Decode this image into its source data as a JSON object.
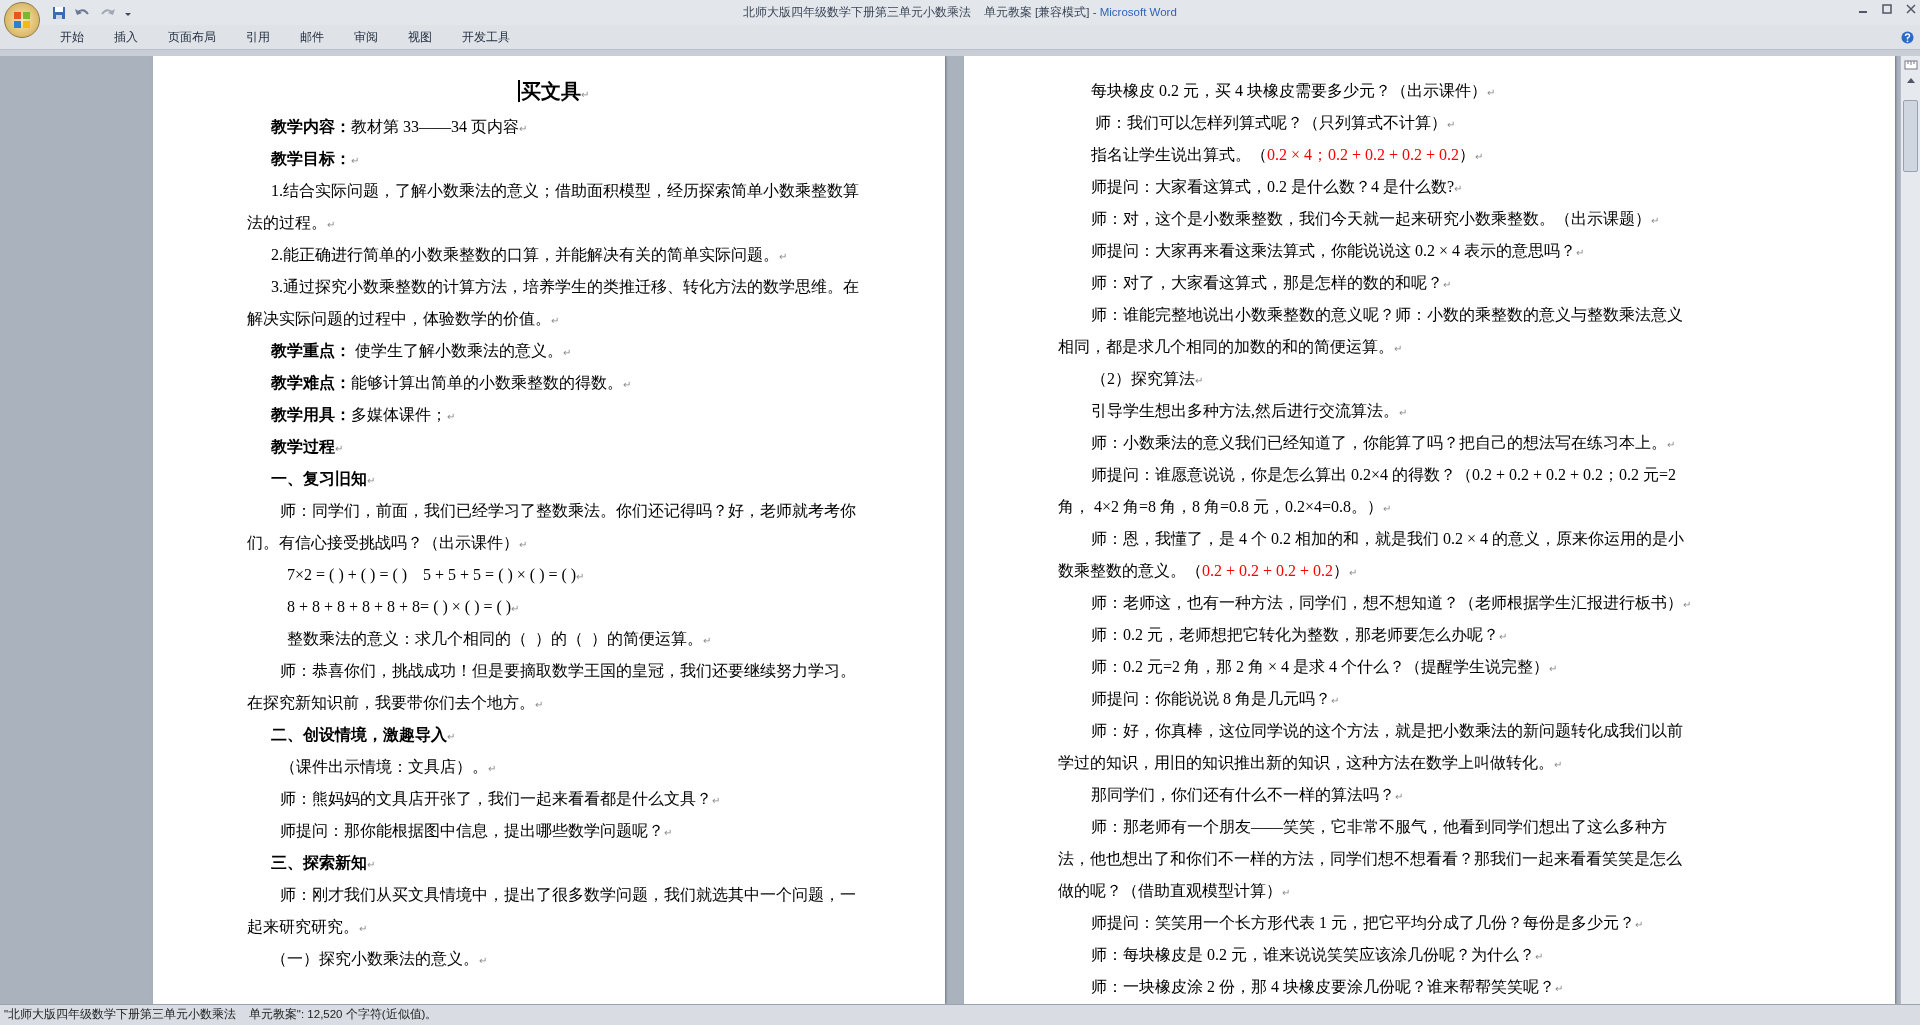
{
  "window": {
    "title": "北师大版四年级数学下册第三单元小数乘法    单元教案 [兼容模式] - ",
    "app_name": "Microsoft Word"
  },
  "ribbon_tabs": [
    {
      "label": "开始"
    },
    {
      "label": "插入"
    },
    {
      "label": "页面布局"
    },
    {
      "label": "引用"
    },
    {
      "label": "邮件"
    },
    {
      "label": "审阅"
    },
    {
      "label": "视图"
    },
    {
      "label": "开发工具"
    }
  ],
  "pages": [
    {
      "paragraphs": [
        {
          "kind": "title",
          "text": "买文具",
          "end": "↵"
        },
        {
          "kind": "item",
          "text": "**教学内容：**教材第 33——34 页内容",
          "end": "↵"
        },
        {
          "kind": "heading",
          "text": "教学目标：",
          "end": "↵"
        },
        {
          "kind": "item",
          "text": "1.结合实际问题，了解小数乘法的意义；借助面积模型，经历探索简单小数乘整数算法的过程。",
          "end": "↵"
        },
        {
          "kind": "item",
          "text": "2.能正确进行简单的小数乘整数的口算，并能解决有关的简单实际问题。",
          "end": "↵"
        },
        {
          "kind": "item",
          "text": "3.通过探究小数乘整数的计算方法，培养学生的类推迁移、转化方法的数学思维。在解决实际问题的过程中，体验数学的价值。",
          "end": "↵"
        },
        {
          "kind": "item",
          "text": "**教学重点：** 使学生了解小数乘法的意义。",
          "end": "↵"
        },
        {
          "kind": "item",
          "text": "**教学难点：**能够计算出简单的小数乘整数的得数。",
          "end": "↵"
        },
        {
          "kind": "item",
          "text": "**教学用具：**多媒体课件；",
          "end": "↵"
        },
        {
          "kind": "heading",
          "text": "教学过程",
          "end": "↵"
        },
        {
          "kind": "heading",
          "text": "一、复习旧知",
          "end": "↵"
        },
        {
          "kind": "dialogue",
          "text": "师：同学们，前面，我们已经学习了整数乘法。你们还记得吗？好，老师就考考你们。有信心接受挑战吗？（出示课件）",
          "end": "↵"
        },
        {
          "kind": "formula",
          "text": "7×2 = ( ) + ( ) = ( )    5 + 5 + 5 = ( ) × ( ) = ( )",
          "end": "↵"
        },
        {
          "kind": "formula",
          "text": "8 + 8 + 8 + 8 + 8 + 8= ( ) × ( ) = ( )",
          "end": "↵"
        },
        {
          "kind": "formula",
          "text": "整数乘法的意义：求几个相同的（  ）的（  ）的简便运算。",
          "end": "↵"
        },
        {
          "kind": "dialogue",
          "text": "师：恭喜你们，挑战成功！但是要摘取数学王国的皇冠，我们还要继续努力学习。在探究新知识前，我要带你们去个地方。",
          "end": "↵"
        },
        {
          "kind": "heading",
          "text": "二、创设情境，激趣导入",
          "end": "↵"
        },
        {
          "kind": "dialogue",
          "text": "（课件出示情境：文具店）。",
          "end": "↵"
        },
        {
          "kind": "dialogue",
          "text": "师：熊妈妈的文具店开张了，我们一起来看看都是什么文具？",
          "end": "↵"
        },
        {
          "kind": "dialogue",
          "text": "师提问：那你能根据图中信息，提出哪些数学问题呢？",
          "end": "↵"
        },
        {
          "kind": "heading",
          "text": "三、探索新知",
          "end": "↵"
        },
        {
          "kind": "dialogue",
          "text": "师：刚才我们从买文具情境中，提出了很多数学问题，我们就选其中一个问题，一起来研究研究。",
          "end": "↵"
        },
        {
          "kind": "item",
          "text": "（一）探究小数乘法的意义。",
          "end": "↵"
        }
      ]
    },
    {
      "paragraphs": [
        {
          "kind": "dialogue",
          "text": "每块橡皮 0.2 元，买 4 块橡皮需要多少元？（出示课件）",
          "end": "↵"
        },
        {
          "kind": "dialogue",
          "text": " 师：我们可以怎样列算式呢？（只列算式不计算）",
          "end": "↵"
        },
        {
          "kind": "dialogue",
          "parts": [
            {
              "text": "指名让学生说出算式。（"
            },
            {
              "text": "0.2 × 4；0.2 + 0.2 + 0.2 + 0.2",
              "color": "#ff0000"
            },
            {
              "text": "）"
            }
          ],
          "end": "↵"
        },
        {
          "kind": "dialogue",
          "text": "师提问：大家看这算式，0.2 是什么数？4 是什么数?",
          "end": "↵"
        },
        {
          "kind": "dialogue",
          "text": "师：对，这个是小数乘整数，我们今天就一起来研究小数乘整数。（出示课题）",
          "end": "↵"
        },
        {
          "kind": "dialogue",
          "text": "师提问：大家再来看这乘法算式，你能说说这 0.2 × 4 表示的意思吗？",
          "end": "↵"
        },
        {
          "kind": "dialogue",
          "text": "师：对了，大家看这算式，那是怎样的数的和呢？",
          "end": "↵"
        },
        {
          "kind": "dialogue",
          "text": "师：谁能完整地说出小数乘整数的意义呢？师：小数的乘整数的意义与整数乘法意义相同，都是求几个相同的加数的和的简便运算。",
          "end": "↵"
        },
        {
          "kind": "dialogue",
          "text": "（2）探究算法",
          "end": "↵"
        },
        {
          "kind": "dialogue",
          "text": "引导学生想出多种方法,然后进行交流算法。",
          "end": "↵"
        },
        {
          "kind": "dialogue",
          "text": "师：小数乘法的意义我们已经知道了，你能算了吗？把自己的想法写在练习本上。",
          "end": "↵"
        },
        {
          "kind": "dialogue",
          "text": "师提问：谁愿意说说，你是怎么算出 0.2×4 的得数？（0.2 + 0.2 + 0.2 + 0.2；0.2 元=2 角， 4×2 角=8 角，8 角=0.8 元，0.2×4=0.8。）",
          "end": "↵"
        },
        {
          "kind": "dialogue",
          "parts": [
            {
              "text": "师：恩，我懂了，是 4 个 0.2 相加的和，就是我们 0.2 × 4 的意义，原来你运用的是小数乘整数的意义。（"
            },
            {
              "text": "0.2 + 0.2 + 0.2 + 0.2",
              "color": "#ff0000"
            },
            {
              "text": "）"
            }
          ],
          "end": "↵"
        },
        {
          "kind": "dialogue",
          "text": "师：老师这，也有一种方法，同学们，想不想知道？（老师根据学生汇报进行板书）",
          "end": "↵"
        },
        {
          "kind": "dialogue",
          "text": "师：0.2 元，老师想把它转化为整数，那老师要怎么办呢？",
          "end": "↵"
        },
        {
          "kind": "dialogue",
          "text": "师：0.2 元=2 角，那 2 角 × 4 是求 4 个什么？（提醒学生说完整）",
          "end": "↵"
        },
        {
          "kind": "dialogue",
          "text": "师提问：你能说说 8 角是几元吗？",
          "end": "↵"
        },
        {
          "kind": "dialogue",
          "text": "师：好，你真棒，这位同学说的这个方法，就是把小数乘法的新问题转化成我们以前学过的知识，用旧的知识推出新的知识，这种方法在数学上叫做转化。",
          "end": "↵"
        },
        {
          "kind": "dialogue",
          "text": "那同学们，你们还有什么不一样的算法吗？",
          "end": "↵"
        },
        {
          "kind": "dialogue",
          "text": "师：那老师有一个朋友——笑笑，它非常不服气，他看到同学们想出了这么多种方法，他也想出了和你们不一样的方法，同学们想不想看看？那我们一起来看看笑笑是怎么做的呢？（借助直观模型计算）",
          "end": "↵"
        },
        {
          "kind": "dialogue",
          "text": "师提问：笑笑用一个长方形代表 1 元，把它平均分成了几份？每份是多少元？",
          "end": "↵"
        },
        {
          "kind": "dialogue",
          "text": "师：每块橡皮是 0.2 元，谁来说说笑笑应该涂几份呢？为什么？",
          "end": "↵"
        },
        {
          "kind": "dialogue",
          "text": "师：一块橡皮涂 2 份，那 4 块橡皮要涂几份呢？谁来帮帮笑笑呢？",
          "end": "↵"
        }
      ]
    }
  ],
  "status_bar": {
    "text": "\"北师大版四年级数学下册第三单元小数乘法    单元教案\": 12,520 个字符(近似值)。"
  }
}
